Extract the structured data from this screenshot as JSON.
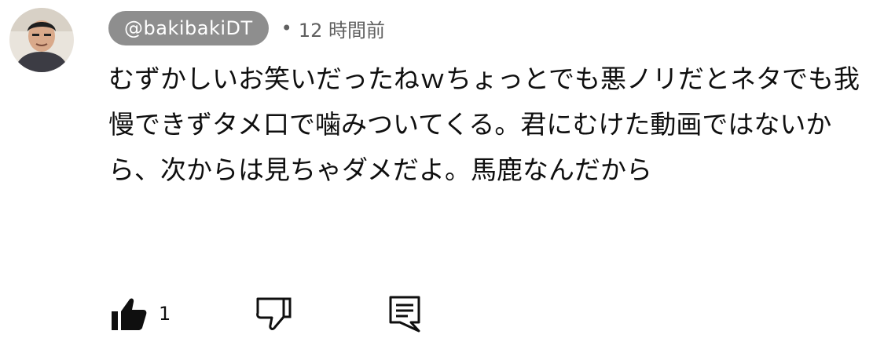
{
  "comment": {
    "author": "@bakibakiDT",
    "separator": "•",
    "timestamp": "12 時間前",
    "text": "むずかしいお笑いだったねｗちょっとでも悪ノリだとネタでも我慢できずタメ口で噛みついてくる。君にむけた動画ではないから、次からは見ちゃダメだよ。馬鹿なんだから"
  },
  "actions": {
    "like_count": "1",
    "like_icon": "thumb-up-filled-icon",
    "dislike_icon": "thumb-down-outline-icon",
    "reply_icon": "comment-reply-icon"
  },
  "colors": {
    "author_chip_bg": "#8e8e8e",
    "meta_text": "#606060",
    "body_text": "#0f0f0f"
  }
}
